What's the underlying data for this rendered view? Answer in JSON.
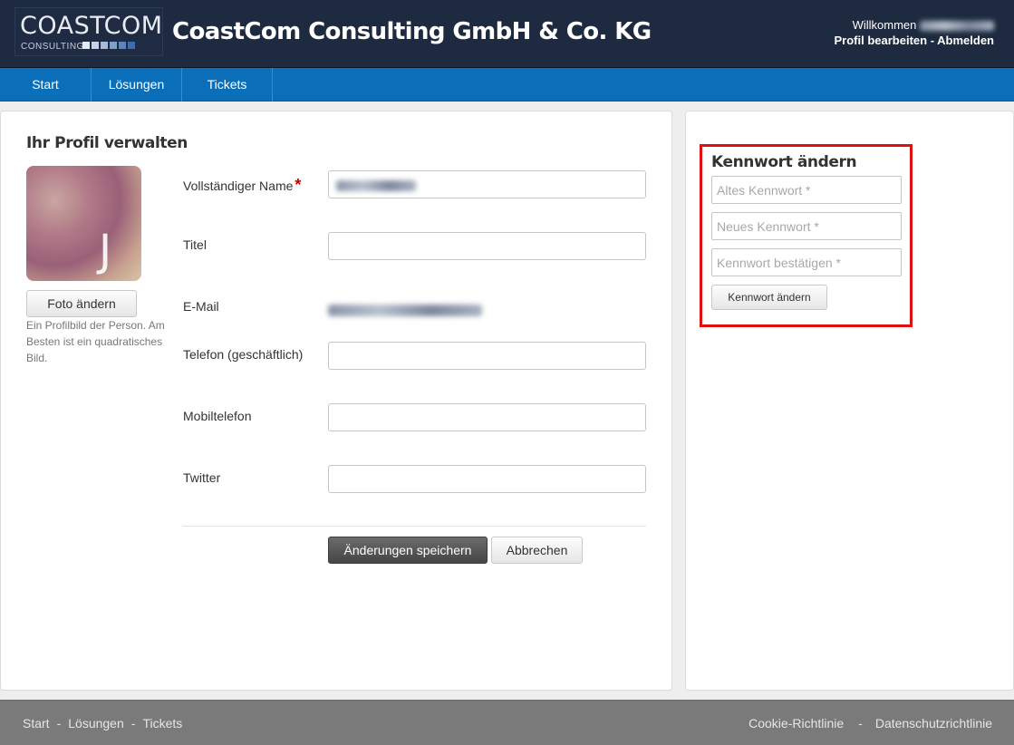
{
  "header": {
    "logo_main": "COASTCOM",
    "logo_sub": "CONSULTING",
    "logo_square_colors": [
      "#e6ecf5",
      "#c5d3e8",
      "#a3badb",
      "#7f9fcc",
      "#5c85bf",
      "#3b6bb1"
    ],
    "company_title": "CoastCom Consulting GmbH & Co. KG",
    "welcome_text": "Willkommen",
    "edit_profile_link": "Profil bearbeiten",
    "link_separator": " - ",
    "logout_link": "Abmelden"
  },
  "nav": {
    "items": [
      {
        "label": "Start"
      },
      {
        "label": "Lösungen"
      },
      {
        "label": "Tickets"
      }
    ]
  },
  "profile": {
    "title": "Ihr Profil verwalten",
    "avatar_letter": "J",
    "photo_button": "Foto ändern",
    "photo_help": "Ein Profilbild der Person. Am Besten ist ein quadratisches Bild.",
    "fields": {
      "full_name_label": "Vollständiger Name",
      "required_mark": "*",
      "title_label": "Titel",
      "email_label": "E-Mail",
      "phone_label": "Telefon (geschäftlich)",
      "mobile_label": "Mobiltelefon",
      "twitter_label": "Twitter"
    },
    "save_button": "Änderungen speichern",
    "cancel_button": "Abbrechen"
  },
  "password": {
    "title": "Kennwort ändern",
    "old_placeholder": "Altes Kennwort *",
    "new_placeholder": "Neues Kennwort *",
    "confirm_placeholder": "Kennwort bestätigen *",
    "submit_button": "Kennwort ändern",
    "highlight_color": "#e01010"
  },
  "footer": {
    "left_links": [
      {
        "label": "Start"
      },
      {
        "label": "Lösungen"
      },
      {
        "label": "Tickets"
      }
    ],
    "separator": "-",
    "right_links": [
      {
        "label": "Cookie-Richtlinie"
      },
      {
        "label": "Datenschutzrichtlinie"
      }
    ]
  },
  "colors": {
    "header_bg": "#1d2a3f",
    "nav_bg": "#0a6fb8",
    "footer_bg": "#7a7a7a"
  }
}
